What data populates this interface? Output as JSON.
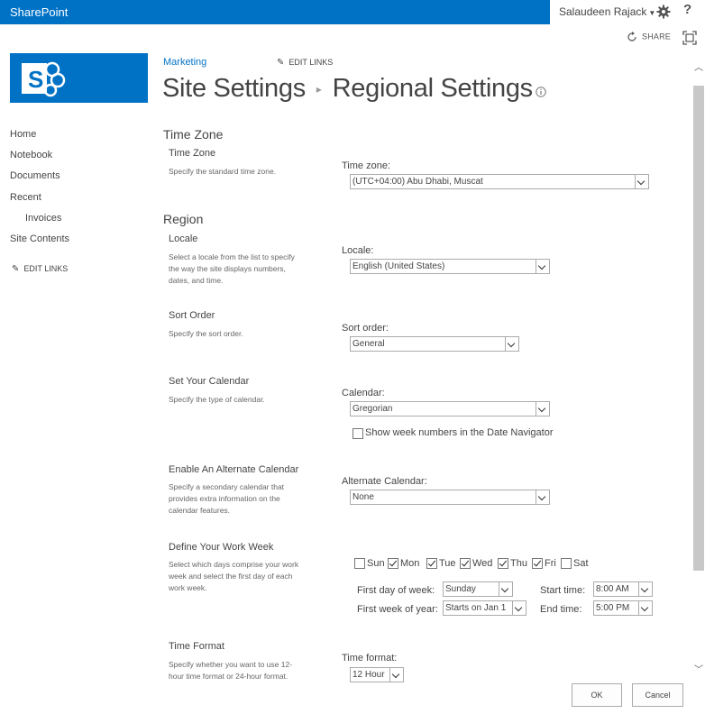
{
  "suite": {
    "brand": "SharePoint",
    "user": "Salaudeen Rajack",
    "help": "?"
  },
  "actions": {
    "share": "SHARE"
  },
  "header": {
    "breadcrumb_top": "Marketing",
    "edit_links": "EDIT LINKS",
    "title_part1": "Site Settings",
    "title_part2": "Regional Settings"
  },
  "nav": {
    "items": [
      "Home",
      "Notebook",
      "Documents",
      "Recent",
      "Invoices",
      "Site Contents"
    ],
    "edit_links": "EDIT LINKS"
  },
  "time_zone": {
    "heading": "Time Zone",
    "title": "Time Zone",
    "desc": "Specify the standard time zone.",
    "label": "Time zone:",
    "value": "(UTC+04:00) Abu Dhabi, Muscat"
  },
  "region": {
    "heading": "Region",
    "locale": {
      "title": "Locale",
      "desc1": "Select a locale from the list to specify",
      "desc2": "the way the site displays numbers,",
      "desc3": "dates, and time.",
      "label": "Locale:",
      "value": "English (United States)"
    },
    "sort": {
      "title": "Sort Order",
      "desc": "Specify the sort order.",
      "label": "Sort order:",
      "value": "General"
    },
    "calendar": {
      "title": "Set Your Calendar",
      "desc": "Specify the type of calendar.",
      "label": "Calendar:",
      "value": "Gregorian",
      "week_numbers": "Show week numbers in the Date Navigator"
    },
    "alt_calendar": {
      "title": "Enable An Alternate Calendar",
      "desc1": "Specify a secondary calendar that",
      "desc2": "provides extra information on the",
      "desc3": "calendar features.",
      "label": "Alternate Calendar:",
      "value": "None"
    },
    "work_week": {
      "title": "Define Your Work Week",
      "desc1": "Select which days comprise your work",
      "desc2": "week and select the first day of each",
      "desc3": "work week.",
      "days": [
        "Sun",
        "Mon",
        "Tue",
        "Wed",
        "Thu",
        "Fri",
        "Sat"
      ],
      "first_day_label": "First day of week:",
      "first_day_value": "Sunday",
      "first_week_label": "First week of year:",
      "first_week_value": "Starts on Jan 1",
      "start_label": "Start time:",
      "start_value": "8:00 AM",
      "end_label": "End time:",
      "end_value": "5:00 PM"
    },
    "time_format": {
      "title": "Time Format",
      "desc1": "Specify whether you want to use 12-",
      "desc2": "hour time format or 24-hour format.",
      "label": "Time format:",
      "value": "12 Hour"
    }
  },
  "buttons": {
    "ok": "OK",
    "cancel": "Cancel"
  },
  "colors": {
    "accent": "#0072c6"
  }
}
